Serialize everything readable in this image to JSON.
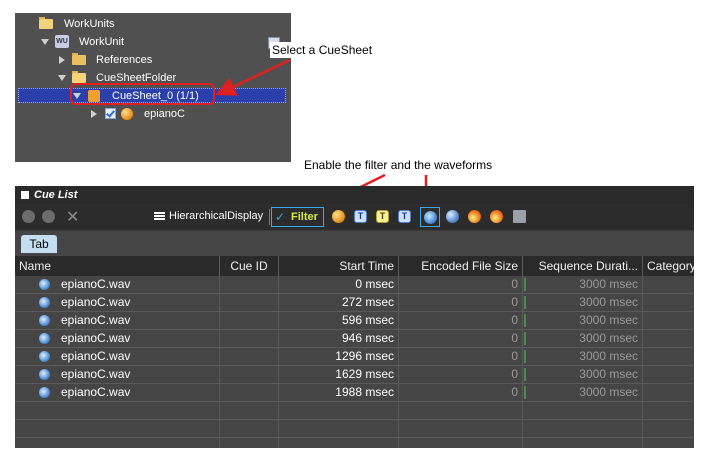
{
  "tree": {
    "items": [
      {
        "label": "WorkUnits"
      },
      {
        "label": "WorkUnit",
        "icon_text": "WU"
      },
      {
        "label": "References"
      },
      {
        "label": "CueSheetFolder"
      },
      {
        "label": "CueSheet_0  (1/1)"
      },
      {
        "label": "epianoC"
      }
    ]
  },
  "callouts": {
    "select_cuesheet": "Select a CueSheet",
    "enable_filter": "Enable the filter and the waveforms"
  },
  "cue_list": {
    "title": "Cue List",
    "toolbar": {
      "hierarchical_label": "HierarchicalDisplay",
      "filter_label": "Filter",
      "icon_T": "T"
    },
    "tab_label": "Tab",
    "columns": [
      "Name",
      "Cue ID",
      "Start Time",
      "Encoded File Size",
      "Sequence Durati...",
      "Category"
    ],
    "rows": [
      {
        "name": "epianoC.wav",
        "cue_id": "",
        "start_time": "0 msec",
        "encoded_size": "0",
        "duration": "3000 msec"
      },
      {
        "name": "epianoC.wav",
        "cue_id": "",
        "start_time": "272 msec",
        "encoded_size": "0",
        "duration": "3000 msec"
      },
      {
        "name": "epianoC.wav",
        "cue_id": "",
        "start_time": "596 msec",
        "encoded_size": "0",
        "duration": "3000 msec"
      },
      {
        "name": "epianoC.wav",
        "cue_id": "",
        "start_time": "946 msec",
        "encoded_size": "0",
        "duration": "3000 msec"
      },
      {
        "name": "epianoC.wav",
        "cue_id": "",
        "start_time": "1296 msec",
        "encoded_size": "0",
        "duration": "3000 msec"
      },
      {
        "name": "epianoC.wav",
        "cue_id": "",
        "start_time": "1629 msec",
        "encoded_size": "0",
        "duration": "3000 msec"
      },
      {
        "name": "epianoC.wav",
        "cue_id": "",
        "start_time": "1988 msec",
        "encoded_size": "0",
        "duration": "3000 msec"
      }
    ]
  }
}
